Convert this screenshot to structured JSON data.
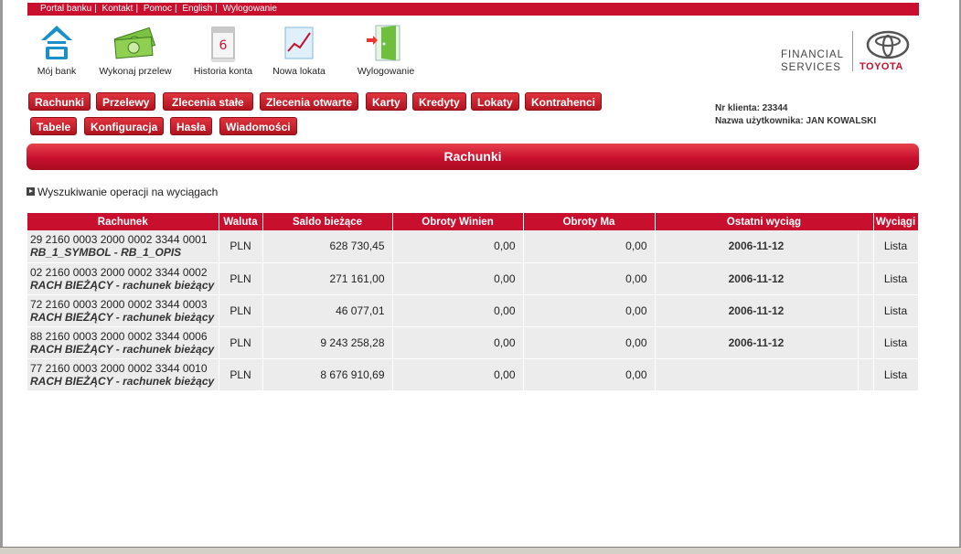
{
  "topbar": {
    "links": [
      "Portal banku",
      "Kontakt",
      "Pomoc",
      "English",
      "Wylogowanie"
    ]
  },
  "toolbar": {
    "my_bank": "Mój bank",
    "transfer": "Wykonaj przelew",
    "history": "Historia konta",
    "deposit": "Nowa lokata",
    "logout": "Wylogowanie"
  },
  "logo": {
    "line1": "FINANCIAL",
    "line2": "SERVICES",
    "brand": "TOYOTA"
  },
  "nav": {
    "row1": [
      "Rachunki",
      "Przelewy",
      "Zlecenia stałe",
      "Zlecenia otwarte",
      "Karty",
      "Kredyty",
      "Lokaty",
      "Kontrahenci"
    ],
    "row2": [
      "Tabele",
      "Konfiguracja",
      "Hasła",
      "Wiadomości"
    ]
  },
  "client": {
    "number": "Nr klienta: 23344",
    "user": "Nazwa użytkownika: JAN KOWALSKI"
  },
  "section_title": "Rachunki",
  "search_link": "Wyszukiwanie operacji na wyciągach",
  "table": {
    "headers": [
      "Rachunek",
      "Waluta",
      "Saldo bieżące",
      "Obroty Winien",
      "Obroty Ma",
      "Ostatni wyciąg",
      "Wyciągi"
    ],
    "rows": [
      {
        "number": "29 2160 0003 2000 0002 3344 0001",
        "desc": "RB_1_SYMBOL - RB_1_OPIS",
        "currency": "PLN",
        "balance": "628 730,45",
        "debit": "0,00",
        "credit": "0,00",
        "last": "2006-11-12",
        "link": "Lista"
      },
      {
        "number": "02 2160 0003 2000 0002 3344 0002",
        "desc": "RACH BIEŻĄCY - rachunek bieżący",
        "currency": "PLN",
        "balance": "271 161,00",
        "debit": "0,00",
        "credit": "0,00",
        "last": "2006-11-12",
        "link": "Lista"
      },
      {
        "number": "72 2160 0003 2000 0002 3344 0003",
        "desc": "RACH BIEŻĄCY - rachunek bieżący",
        "currency": "PLN",
        "balance": "46 077,01",
        "debit": "0,00",
        "credit": "0,00",
        "last": "2006-11-12",
        "link": "Lista"
      },
      {
        "number": "88 2160 0003 2000 0002 3344 0006",
        "desc": "RACH BIEŻĄCY - rachunek bieżący",
        "currency": "PLN",
        "balance": "9 243 258,28",
        "debit": "0,00",
        "credit": "0,00",
        "last": "2006-11-12",
        "link": "Lista"
      },
      {
        "number": "77 2160 0003 2000 0002 3344 0010",
        "desc": "RACH BIEŻĄCY - rachunek bieżący",
        "currency": "PLN",
        "balance": "8 676 910,69",
        "debit": "0,00",
        "credit": "0,00",
        "last": "",
        "link": "Lista"
      }
    ]
  },
  "colors": {
    "accent": "#c8102e",
    "row_bg": "#ececec"
  }
}
